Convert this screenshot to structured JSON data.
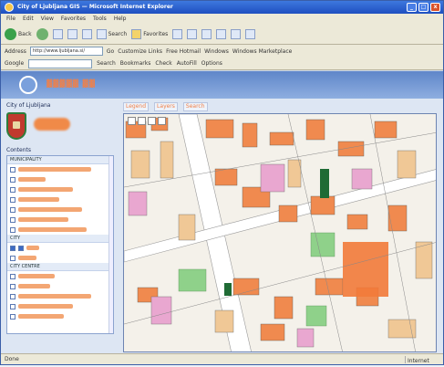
{
  "window": {
    "title": "City of Ljubljana GIS — Microsoft Internet Explorer",
    "min": "_",
    "max": "□",
    "close": "x"
  },
  "menu": [
    "File",
    "Edit",
    "View",
    "Favorites",
    "Tools",
    "Help"
  ],
  "toolbar": {
    "back": "Back",
    "search": "Search",
    "favorites": "Favorites"
  },
  "address": {
    "label": "Address",
    "value": "http://www.ljubljana.si/",
    "go": "Go",
    "links": [
      "Customize Links",
      "Free Hotmail",
      "Windows",
      "Windows Marketplace"
    ]
  },
  "linksbar": {
    "google": "Google",
    "search": "Search",
    "bookmarks": "Bookmarks",
    "check": "Check",
    "autofill": "AutoFill",
    "options": "Options"
  },
  "page": {
    "city_label": "City of Ljubljana",
    "layers_label": "Contents",
    "groups": [
      "MUNICIPALITY",
      "CITY",
      "CITY CENTRE"
    ],
    "tabs": [
      "Legend",
      "Layers",
      "Search"
    ]
  },
  "status": {
    "text": "Done",
    "zone": "Internet"
  },
  "colors": {
    "accent": "#f08048",
    "header": "#6b90d2",
    "building": "#f08a4f",
    "residential": "#f0c896"
  }
}
